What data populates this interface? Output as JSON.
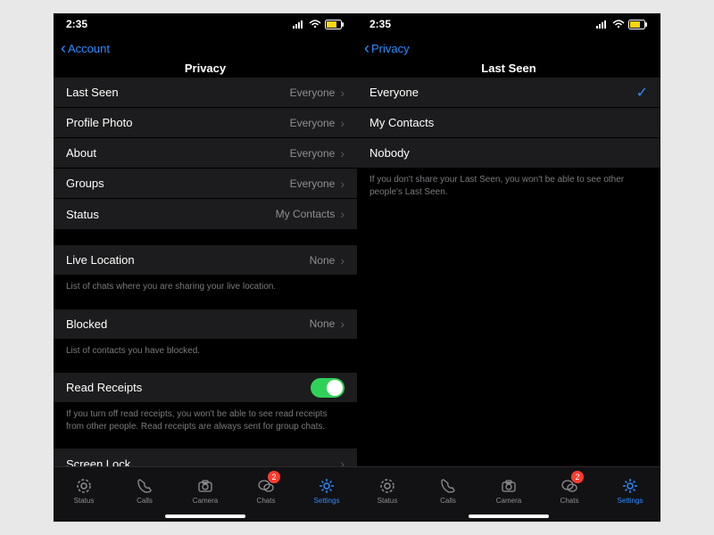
{
  "statusbar": {
    "time": "2:35"
  },
  "left": {
    "back": "Account",
    "title": "Privacy",
    "group1": [
      {
        "label": "Last Seen",
        "value": "Everyone"
      },
      {
        "label": "Profile Photo",
        "value": "Everyone"
      },
      {
        "label": "About",
        "value": "Everyone"
      },
      {
        "label": "Groups",
        "value": "Everyone"
      },
      {
        "label": "Status",
        "value": "My Contacts"
      }
    ],
    "liveLoc": {
      "label": "Live Location",
      "value": "None",
      "footer": "List of chats where you are sharing your live location."
    },
    "blocked": {
      "label": "Blocked",
      "value": "None",
      "footer": "List of contacts you have blocked."
    },
    "readReceipts": {
      "label": "Read Receipts",
      "footer": "If you turn off read receipts, you won't be able to see read receipts from other people. Read receipts are always sent for group chats."
    },
    "screenLock": {
      "label": "Screen Lock"
    }
  },
  "right": {
    "back": "Privacy",
    "title": "Last Seen",
    "options": [
      {
        "label": "Everyone",
        "selected": true
      },
      {
        "label": "My Contacts",
        "selected": false
      },
      {
        "label": "Nobody",
        "selected": false
      }
    ],
    "footer": "If you don't share your Last Seen, you won't be able to see other people's Last Seen."
  },
  "tabs": [
    {
      "label": "Status"
    },
    {
      "label": "Calls"
    },
    {
      "label": "Camera"
    },
    {
      "label": "Chats",
      "badge": "2"
    },
    {
      "label": "Settings",
      "active": true
    }
  ]
}
